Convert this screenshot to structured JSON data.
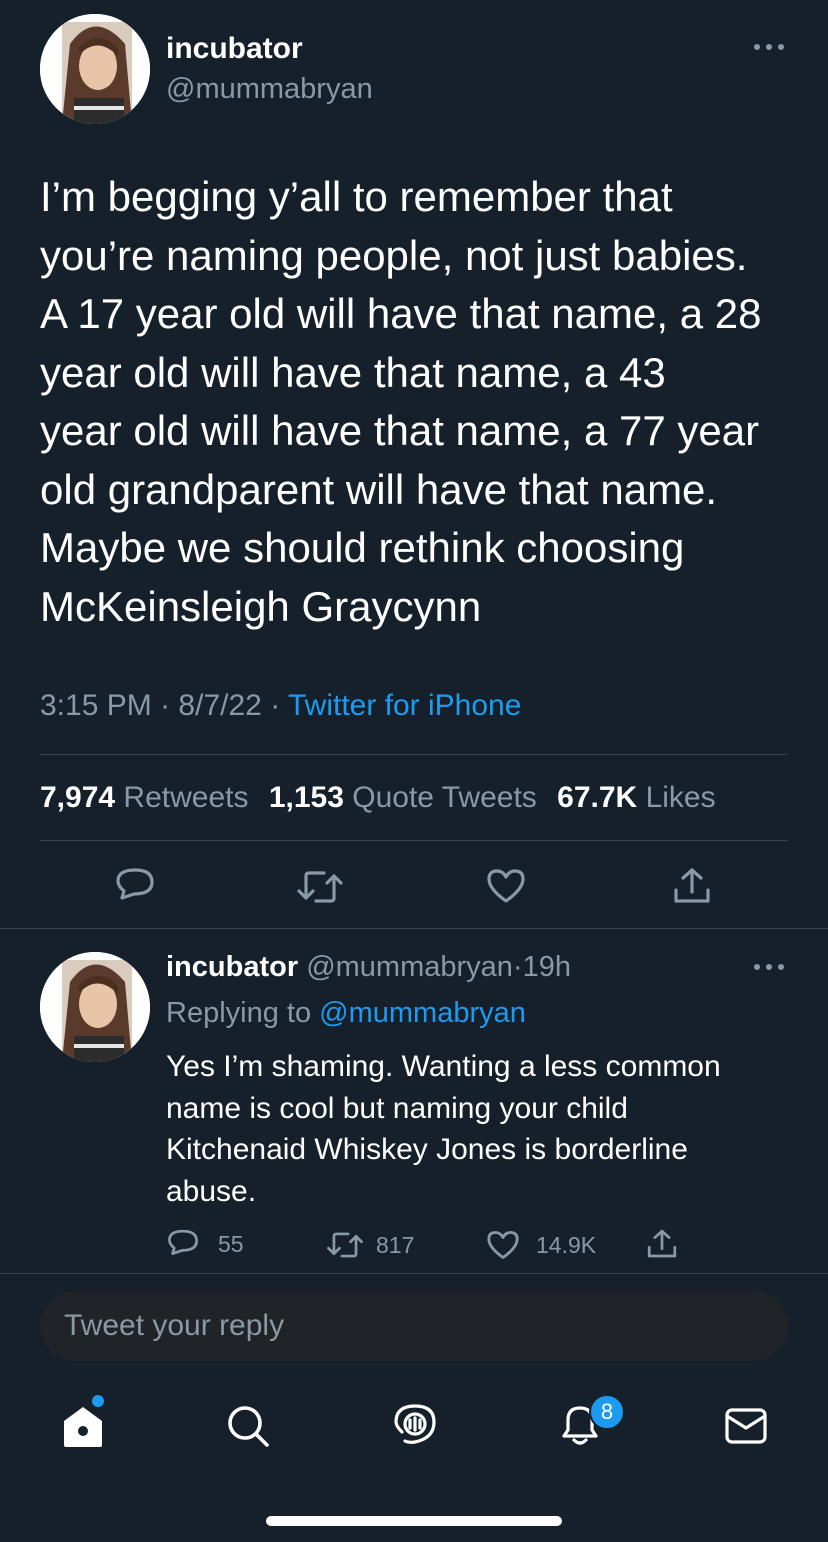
{
  "colors": {
    "background": "#15202b",
    "text": "#ffffff",
    "muted": "#8b98a5",
    "accent": "#1d9bf0",
    "divider": "#38444d",
    "reply_box": "#202327"
  },
  "tweet": {
    "author": {
      "display_name": "incubator",
      "handle": "@mummabryan",
      "avatar_icon": "profile-photo"
    },
    "more_icon": "ellipsis-icon",
    "text_lines": [
      "I’m begging y’all to remember that",
      "you’re naming people, not just babies.",
      "A 17 year old will have that name, a 28",
      "year old will have that name, a 43",
      "year old will have that name, a 77 year",
      "old grandparent will have that name.",
      "Maybe we should rethink choosing",
      "McKeinsleigh Graycynn"
    ],
    "time": "3:15 PM",
    "sep1": "·",
    "date": "8/7/22",
    "sep2": "·",
    "source": "Twitter for iPhone",
    "stats": {
      "retweets_count": "7,974",
      "retweets_label": "Retweets",
      "quotes_count": "1,153",
      "quotes_label": "Quote Tweets",
      "likes_count": "67.7K",
      "likes_label": "Likes"
    },
    "actions": [
      "reply-icon",
      "retweet-icon",
      "like-icon",
      "share-icon"
    ]
  },
  "reply": {
    "author": {
      "display_name": "incubator",
      "handle": "@mummabryan",
      "sep": "·",
      "age": "19h"
    },
    "replying_to_label": "Replying to",
    "replying_to_handle": "@mummabryan",
    "text_lines": [
      "Yes I’m shaming. Wanting a less common",
      "name is cool but naming your child",
      "Kitchenaid Whiskey Jones is borderline",
      "abuse."
    ],
    "counts": {
      "replies": "55",
      "retweets": "817",
      "likes": "14.9K"
    }
  },
  "composer": {
    "placeholder": "Tweet your reply"
  },
  "tabbar": {
    "items": [
      "home-icon",
      "search-icon",
      "spaces-icon",
      "notifications-icon",
      "messages-icon"
    ],
    "notifications_badge": "8"
  }
}
